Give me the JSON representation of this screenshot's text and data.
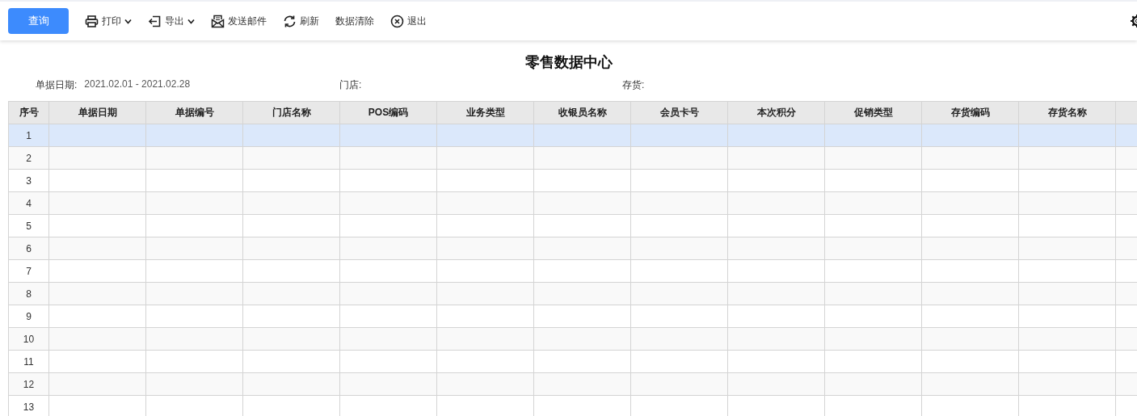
{
  "toolbar": [
    {
      "label": "查询",
      "kind": "primary",
      "dropdown": false
    },
    {
      "label": "打印",
      "kind": "print",
      "dropdown": true
    },
    {
      "label": "导出",
      "kind": "export",
      "dropdown": true
    },
    {
      "label": "发送邮件",
      "kind": "mail",
      "dropdown": false
    },
    {
      "label": "刷新",
      "kind": "refresh",
      "dropdown": false
    },
    {
      "label": "数据清除",
      "kind": "text",
      "dropdown": false
    },
    {
      "label": "退出",
      "kind": "exit",
      "dropdown": false
    }
  ],
  "title": "零售数据中心",
  "filters": [
    {
      "label": "单据日期:",
      "value": "2021.02.01 - 2021.02.28"
    },
    {
      "label": "门店:"
    },
    {
      "label": "存货:"
    }
  ],
  "table": {
    "columns": [
      "序号",
      "单据日期",
      "单据编号",
      "门店名称",
      "POS编码",
      "业务类型",
      "收银员名称",
      "会员卡号",
      "本次积分",
      "促销类型",
      "存货编码",
      "存货名称"
    ],
    "rows": [
      {
        "number": "1",
        "selected": true
      },
      {
        "number": "2",
        "selected": false
      },
      {
        "number": "3",
        "selected": false
      },
      {
        "number": "4",
        "selected": false
      },
      {
        "number": "5",
        "selected": false
      },
      {
        "number": "6",
        "selected": false
      },
      {
        "number": "7",
        "selected": false
      },
      {
        "number": "8",
        "selected": false
      },
      {
        "number": "9",
        "selected": false
      },
      {
        "number": "10",
        "selected": false
      },
      {
        "number": "11",
        "selected": false
      },
      {
        "number": "12",
        "selected": false
      },
      {
        "number": "13",
        "selected": false
      }
    ]
  }
}
